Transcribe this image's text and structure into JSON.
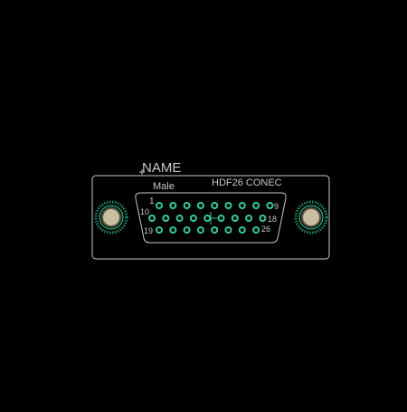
{
  "footprint": {
    "name_label": "NAME",
    "gender_label": "Male",
    "part_label": "HDF26 CONEC",
    "pin_labels": {
      "pin_1": "1",
      "pin_9": "9",
      "pin_10": "10",
      "pin_18": "18",
      "pin_19": "19",
      "pin_26": "26"
    },
    "rows": [
      {
        "row": 1,
        "first_pin": 1,
        "last_pin": 9,
        "count": 9
      },
      {
        "row": 2,
        "first_pin": 10,
        "last_pin": 18,
        "count": 9
      },
      {
        "row": 3,
        "first_pin": 19,
        "last_pin": 26,
        "count": 8
      }
    ],
    "mounting_holes": [
      "left",
      "right"
    ]
  },
  "colors": {
    "background": "#000000",
    "silkscreen": "#c8c8c8",
    "pad": "#33cc99",
    "pad_hole": "#000000",
    "mount_ring": "#1f8a6a",
    "mount_hole_fill": "#c8c0a0"
  }
}
